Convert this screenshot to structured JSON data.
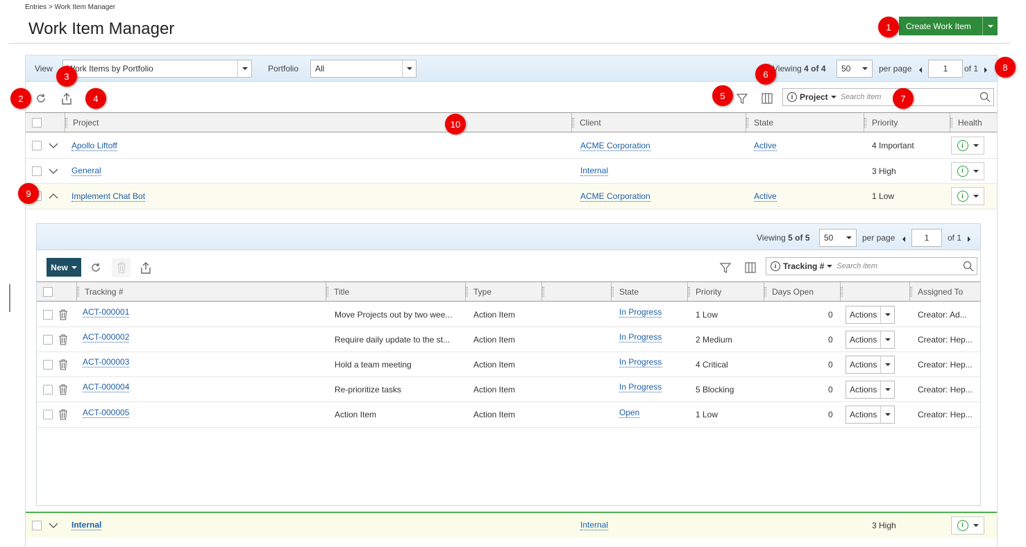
{
  "breadcrumb": "Entries > Work Item Manager",
  "page_title": "Work Item Manager",
  "create_button": "Create Work Item",
  "viewbar": {
    "view_label": "View",
    "view_value": "Work Items by Portfolio",
    "portfolio_label": "Portfolio",
    "portfolio_value": "All",
    "viewing_prefix": "Viewing",
    "viewing_count": "4 of 4",
    "page_size": "50",
    "per_page": "per page",
    "page": "1",
    "of_pages": "of 1"
  },
  "search": {
    "scope": "Project",
    "placeholder": "Search item"
  },
  "columns": [
    "Project",
    "Client",
    "State",
    "Priority",
    "Health"
  ],
  "projects": [
    {
      "project": "Apollo Liftoff",
      "client": "ACME Corporation",
      "state": "Active",
      "priority": "4 Important"
    },
    {
      "project": "General",
      "client": "Internal",
      "state": "",
      "priority": "3 High"
    },
    {
      "project": "Implement Chat Bot",
      "client": "ACME Corporation",
      "state": "Active",
      "priority": "1 Low"
    }
  ],
  "last_project": {
    "project": "Internal",
    "client": "Internal",
    "state": "",
    "priority": "3 High"
  },
  "inner": {
    "viewing_prefix": "Viewing",
    "viewing_count": "5 of 5",
    "page_size": "50",
    "per_page": "per page",
    "page": "1",
    "of_pages": "of 1",
    "new_button": "New",
    "search_scope": "Tracking #",
    "search_placeholder": "Search item",
    "columns": [
      "Tracking #",
      "Title",
      "Type",
      "",
      "State",
      "Priority",
      "Days Open",
      "",
      "Assigned To"
    ],
    "rows": [
      {
        "tracking": "ACT-000001",
        "title": "Move Projects out by two wee...",
        "type": "Action Item",
        "state": "In Progress",
        "priority": "1 Low",
        "days": "0",
        "action": "Actions",
        "assigned": "Creator: Ad..."
      },
      {
        "tracking": "ACT-000002",
        "title": "Require daily update to the st...",
        "type": "Action Item",
        "state": "In Progress",
        "priority": "2 Medium",
        "days": "0",
        "action": "Actions",
        "assigned": "Creator: Hep..."
      },
      {
        "tracking": "ACT-000003",
        "title": "Hold a team meeting",
        "type": "Action Item",
        "state": "In Progress",
        "priority": "4 Critical",
        "days": "0",
        "action": "Actions",
        "assigned": "Creator: Hep..."
      },
      {
        "tracking": "ACT-000004",
        "title": "Re-prioritize tasks",
        "type": "Action Item",
        "state": "In Progress",
        "priority": "5 Blocking",
        "days": "0",
        "action": "Actions",
        "assigned": "Creator: Hep..."
      },
      {
        "tracking": "ACT-000005",
        "title": "Action Item",
        "type": "Action Item",
        "state": "Open",
        "priority": "1 Low",
        "days": "0",
        "action": "Actions",
        "assigned": "Creator: Hep..."
      }
    ]
  },
  "badges": [
    "1",
    "2",
    "3",
    "4",
    "5",
    "6",
    "7",
    "8",
    "9",
    "10"
  ],
  "icons": {
    "health": "info-icon",
    "refresh": "refresh-icon",
    "export": "export-icon",
    "filter": "filter-icon",
    "columns": "columns-icon",
    "search": "search-icon",
    "trash": "trash-icon"
  },
  "colors": {
    "accent_green": "#2e8b3a",
    "link_blue": "#1f5fa6",
    "new_button": "#1d4e63",
    "badge_red": "#e00000"
  }
}
